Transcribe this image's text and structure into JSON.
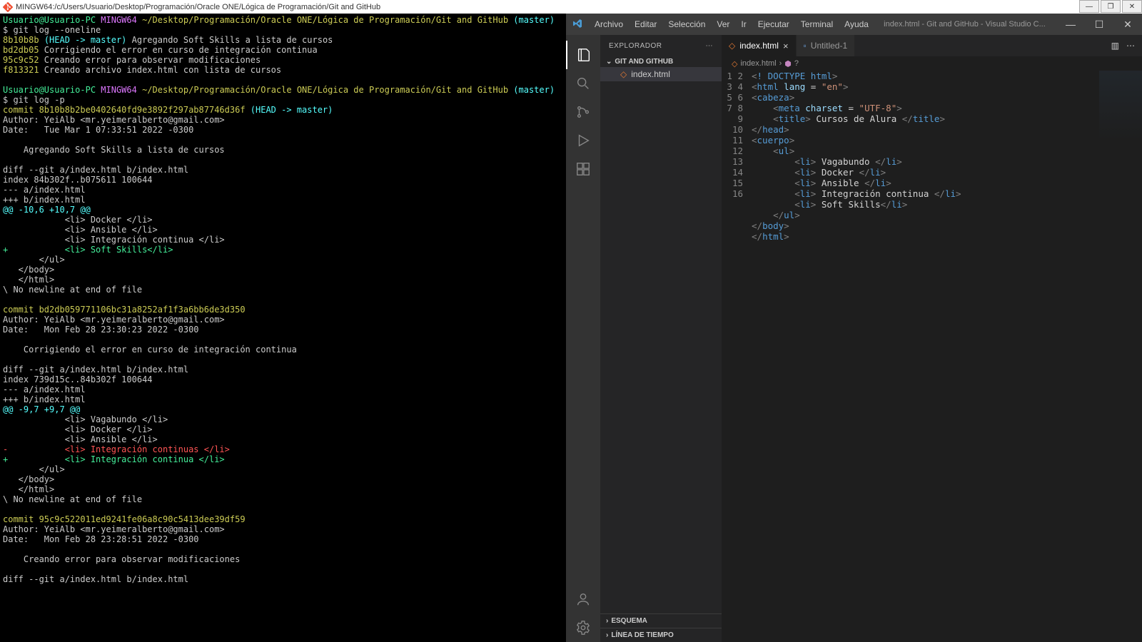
{
  "titlebar": {
    "text": "MINGW64:/c/Users/Usuario/Desktop/Programación/Oracle ONE/Lógica de Programación/Git and GitHub"
  },
  "terminal": {
    "prompt_user": "Usuario@Usuario-PC",
    "prompt_sys": "MINGW64",
    "prompt_path": "~/Desktop/Programación/Oracle ONE/Lógica de Programación/Git and GitHub",
    "prompt_branch": "(master)",
    "cmd1": "git log --oneline",
    "log1_hash": "8b10b8b",
    "log1_ref": "(HEAD -> master)",
    "log1_msg": " Agregando Soft Skills a lista de cursos",
    "log2_hash": "bd2db05",
    "log2_msg": " Corrigiendo el error en curso de integración continua",
    "log3_hash": "95c9c52",
    "log3_msg": " Creando error para observar modificaciones",
    "log4_hash": "f813321",
    "log4_msg": " Creando archivo index.html con lista de cursos",
    "cmd2": "git log -p",
    "c1_commit": "commit 8b10b8b2be0402640fd9e3892f297ab87746d36f ",
    "c1_ref": "(HEAD -> master)",
    "c1_author": "Author: YeiAlb <mr.yeimeralberto@gmail.com>",
    "c1_date": "Date:   Tue Mar 1 07:33:51 2022 -0300",
    "c1_msg": "    Agregando Soft Skills a lista de cursos",
    "diff_hdr": "diff --git a/index.html b/index.html",
    "idx1": "index 84b302f..b075611 100644",
    "file_a": "--- a/index.html",
    "file_b": "+++ b/index.html",
    "hunk1": "@@ -10,6 +10,7 @@",
    "ctx1": "            <li> Docker </li>",
    "ctx2": "            <li> Ansible </li>",
    "ctx3": "            <li> Integración continua </li>",
    "add1": "+           <li> Soft Skills</li>",
    "ctx4": "       </ul>",
    "ctx5": "   </body>",
    "ctx6": "   </html>",
    "noeof": "\\ No newline at end of file",
    "c2_commit": "commit bd2db059771106bc31a8252af1f3a6bb6de3d350",
    "c2_author": "Author: YeiAlb <mr.yeimeralberto@gmail.com>",
    "c2_date": "Date:   Mon Feb 28 23:30:23 2022 -0300",
    "c2_msg": "    Corrigiendo el error en curso de integración continua",
    "idx2": "index 739d15c..84b302f 100644",
    "hunk2": "@@ -9,7 +9,7 @@",
    "ctx7": "            <li> Vagabundo </li>",
    "del1": "-           <li> Integración continuas </li>",
    "add2": "+           <li> Integración continua </li>",
    "c3_commit": "commit 95c9c522011ed9241fe06a8c90c5413dee39df59",
    "c3_author": "Author: YeiAlb <mr.yeimeralberto@gmail.com>",
    "c3_date": "Date:   Mon Feb 28 23:28:51 2022 -0300",
    "c3_msg": "    Creando error para observar modificaciones"
  },
  "vscode": {
    "menu": [
      "Archivo",
      "Editar",
      "Selección",
      "Ver",
      "Ir",
      "Ejecutar",
      "Terminal",
      "Ayuda"
    ],
    "title": "index.html - Git and GitHub - Visual Studio C...",
    "explorer_label": "EXPLORADOR",
    "project_name": "GIT AND GITHUB",
    "file1": "index.html",
    "esquema": "ESQUEMA",
    "linea": "LÍNEA DE TIEMPO",
    "tab1": "index.html",
    "tab2": "Untitled-1",
    "breadcrumb": "index.html",
    "breadcrumb2": "?",
    "code": {
      "l1": [
        "<",
        "!",
        " DOCTYPE html",
        ">"
      ],
      "l2": [
        "<",
        "html",
        " ",
        "lang",
        " = ",
        "\"en\"",
        ">"
      ],
      "l3": [
        "<",
        "cabeza",
        ">"
      ],
      "l4": [
        "    <",
        "meta",
        " ",
        "charset",
        " = ",
        "\"UTF-8\"",
        ">"
      ],
      "l5": [
        "    <",
        "title",
        ">",
        " Cursos de Alura ",
        "</",
        "title",
        ">"
      ],
      "l6": [
        "</",
        "head",
        ">"
      ],
      "l7": [
        "<",
        "cuerpo",
        ">"
      ],
      "l8": [
        "    <",
        "ul",
        ">"
      ],
      "l9": [
        "        <",
        "li",
        ">",
        " Vagabundo ",
        "</",
        "li",
        ">"
      ],
      "l10": [
        "        <",
        "li",
        ">",
        " Docker ",
        "</",
        "li",
        ">"
      ],
      "l11": [
        "        <",
        "li",
        ">",
        " Ansible ",
        "</",
        "li",
        ">"
      ],
      "l12": [
        "        <",
        "li",
        ">",
        " Integración continua ",
        "</",
        "li",
        ">"
      ],
      "l13": [
        "        <",
        "li",
        ">",
        " Soft Skills",
        "</",
        "li",
        ">"
      ],
      "l14": [
        "    </",
        "ul",
        ">"
      ],
      "l15": [
        "</",
        "body",
        ">"
      ],
      "l16": [
        "</",
        "html",
        ">"
      ]
    }
  }
}
